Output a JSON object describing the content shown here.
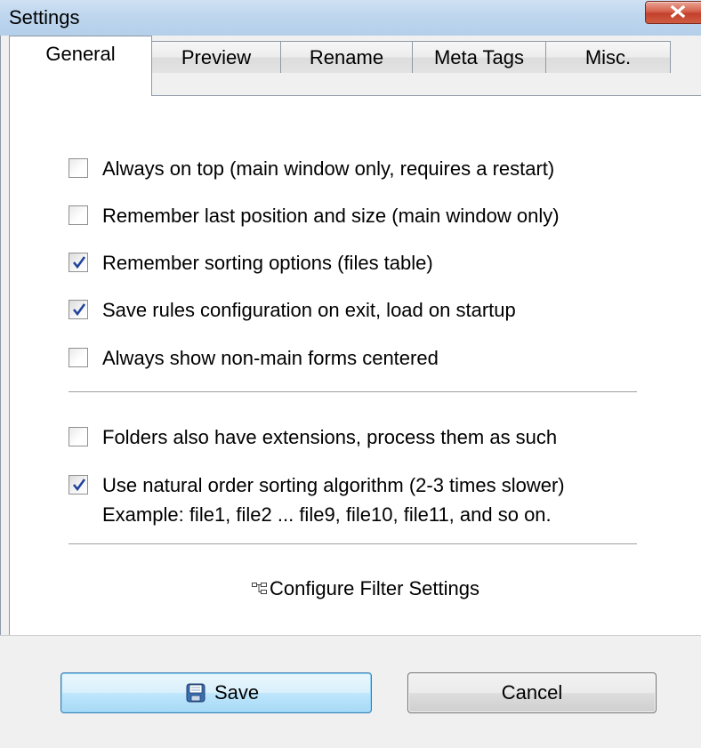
{
  "window": {
    "title": "Settings"
  },
  "tabs": [
    {
      "label": "General",
      "active": true
    },
    {
      "label": "Preview",
      "active": false
    },
    {
      "label": "Rename",
      "active": false
    },
    {
      "label": "Meta Tags",
      "active": false
    },
    {
      "label": "Misc.",
      "active": false
    }
  ],
  "options": [
    {
      "label": "Always on top (main window only, requires a restart)",
      "checked": false
    },
    {
      "label": "Remember last position and size (main window only)",
      "checked": false
    },
    {
      "label": "Remember sorting options (files table)",
      "checked": true
    },
    {
      "label": "Save rules configuration on exit, load on startup",
      "checked": true
    },
    {
      "label": "Always show non-main forms centered",
      "checked": false
    }
  ],
  "options2": [
    {
      "label": "Folders also have extensions, process them as such",
      "checked": false
    },
    {
      "label": "Use natural order sorting algorithm (2-3 times slower)",
      "checked": true,
      "note": "Example: file1, file2 ... file9, file10, file11, and so on."
    }
  ],
  "filter_link": {
    "label": "Configure Filter Settings",
    "icon": "filter-settings-icon"
  },
  "buttons": {
    "save_label": "Save",
    "save_icon": "floppy-disk-icon",
    "cancel_label": "Cancel"
  },
  "colors": {
    "titlebar": "#bed6ee",
    "close_button": "#c3402b",
    "checkmark": "#21439c",
    "default_button_border": "#3c7fb1"
  }
}
